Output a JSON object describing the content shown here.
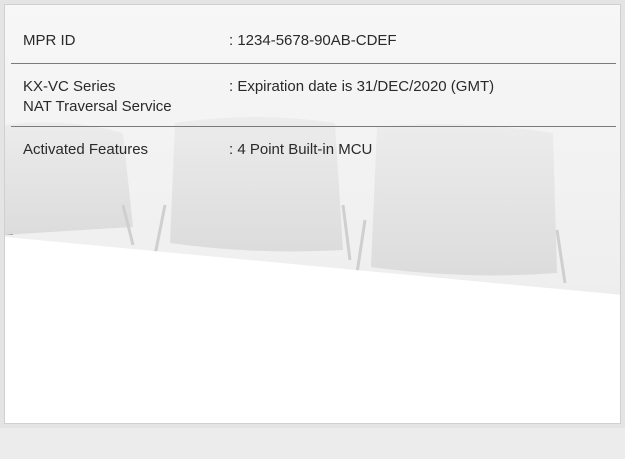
{
  "license_info": {
    "rows": [
      {
        "label_lines": [
          "MPR ID"
        ],
        "value": ": 1234-5678-90AB-CDEF"
      },
      {
        "label_lines": [
          "KX-VC Series",
          "NAT Traversal Service"
        ],
        "value": ": Expiration date is 31/DEC/2020 (GMT)"
      },
      {
        "label_lines": [
          "Activated Features"
        ],
        "value": ": 4 Point Built-in MCU"
      }
    ]
  },
  "colors": {
    "text": "#2a2a2a",
    "divider": "#7b7b7b",
    "panel_background": "#ffffff",
    "outer_background": "#e4e4e4"
  }
}
